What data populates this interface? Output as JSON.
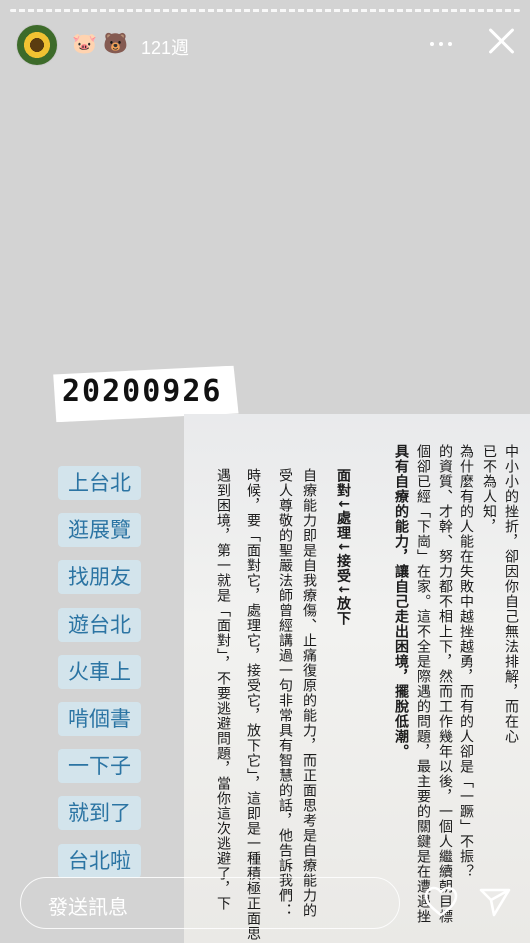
{
  "story": {
    "username_emojis": [
      "🐷",
      "🐻"
    ],
    "time_ago": "121週",
    "date_label": "20200926"
  },
  "sticker_list": [
    "上台北",
    "逛展覽",
    "找朋友",
    "遊台北",
    "火車上",
    "啃個書",
    "一下子",
    "就到了",
    "台北啦"
  ],
  "book_text": [
    {
      "text": "中小小的挫折，卻因你自己無法排解，而在心",
      "bold": false
    },
    {
      "text": "已不為人知，",
      "bold": false
    },
    {
      "text": "為什麼有的人能在失敗中越挫越勇，而有的人卻是「一蹶」不振？",
      "bold": false
    },
    {
      "text": "的資質、才幹、努力都不相上下，然而工作幾年以後，一個人繼續朝目標",
      "bold": false
    },
    {
      "text": "個卻已經「下崗」在家。這不全是際遇的問題，最主要的關鍵是在遭遇挫",
      "bold": false
    },
    {
      "text": "具有自療的能力，讓自己走出困境，擺脫低潮。",
      "bold": true
    },
    {
      "text": "面對↓處理↓接受↓放下",
      "bold": true
    },
    {
      "text": "自療能力即是自我療傷、止痛復原的能力，而正面思考是自療能力的",
      "bold": false
    },
    {
      "text": "受人尊敬的聖嚴法師曾經講過一句非常具有智慧的話，他告訴我們：",
      "bold": false
    },
    {
      "text": "時候，要「面對它，處理它，接受它，放下它」，這即是一種積極正面思",
      "bold": false
    },
    {
      "text": "遇到困境，第一就是「面對」，不要逃避問題，當你這次逃避了，下",
      "bold": false
    }
  ],
  "composer": {
    "placeholder": "發送訊息"
  },
  "colors": {
    "background": "#d3d3d3",
    "sticker_text": "#2b74a3",
    "sticker_bg": "#d2e6f0"
  }
}
